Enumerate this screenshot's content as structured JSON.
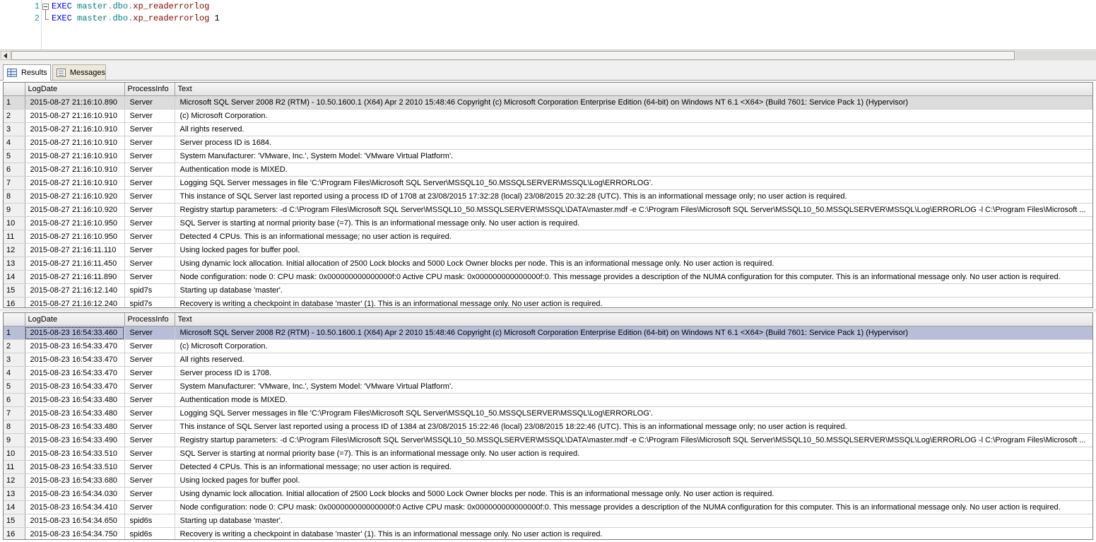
{
  "editor": {
    "lines": [
      {
        "num": "1",
        "exec": "EXEC",
        "db": "master",
        "dot1": ".",
        "schema": "dbo",
        "dot2": ".",
        "proc": "xp_readerrorlog",
        "arg": ""
      },
      {
        "num": "2",
        "exec": "EXEC",
        "db": "master",
        "dot1": ".",
        "schema": "dbo",
        "dot2": ".",
        "proc": "xp_readerrorlog",
        "arg": " 1"
      }
    ]
  },
  "tabs": {
    "results_label": "Results",
    "messages_label": "Messages",
    "results_icon": "grid-icon",
    "messages_icon": "messages-icon"
  },
  "columns": [
    "LogDate",
    "ProcessInfo",
    "Text"
  ],
  "grid1": {
    "rows": [
      {
        "n": "1",
        "date": "2015-08-27 21:16:10.890",
        "proc": "Server",
        "text": "Microsoft SQL Server 2008 R2 (RTM) - 10.50.1600.1 (X64)    Apr  2 2010 15:48:46    Copyright (c) Microsoft Corporation    Enterprise Edition (64-bit) on Windows NT 6.1 <X64> (Build 7601: Service Pack 1) (Hypervisor)"
      },
      {
        "n": "2",
        "date": "2015-08-27 21:16:10.910",
        "proc": "Server",
        "text": "(c) Microsoft Corporation."
      },
      {
        "n": "3",
        "date": "2015-08-27 21:16:10.910",
        "proc": "Server",
        "text": "All rights reserved."
      },
      {
        "n": "4",
        "date": "2015-08-27 21:16:10.910",
        "proc": "Server",
        "text": "Server process ID is 1684."
      },
      {
        "n": "5",
        "date": "2015-08-27 21:16:10.910",
        "proc": "Server",
        "text": "System Manufacturer: 'VMware, Inc.', System Model: 'VMware Virtual Platform'."
      },
      {
        "n": "6",
        "date": "2015-08-27 21:16:10.910",
        "proc": "Server",
        "text": "Authentication mode is MIXED."
      },
      {
        "n": "7",
        "date": "2015-08-27 21:16:10.910",
        "proc": "Server",
        "text": "Logging SQL Server messages in file 'C:\\Program Files\\Microsoft SQL Server\\MSSQL10_50.MSSQLSERVER\\MSSQL\\Log\\ERRORLOG'."
      },
      {
        "n": "8",
        "date": "2015-08-27 21:16:10.920",
        "proc": "Server",
        "text": "This instance of SQL Server last reported using a process ID of 1708 at 23/08/2015 17:32:28 (local) 23/08/2015 20:32:28 (UTC). This is an informational message only; no user action is required."
      },
      {
        "n": "9",
        "date": "2015-08-27 21:16:10.920",
        "proc": "Server",
        "text": "Registry startup parameters:      -d C:\\Program Files\\Microsoft SQL Server\\MSSQL10_50.MSSQLSERVER\\MSSQL\\DATA\\master.mdf      -e C:\\Program Files\\Microsoft SQL Server\\MSSQL10_50.MSSQLSERVER\\MSSQL\\Log\\ERRORLOG      -l C:\\Program Files\\Microsoft ..."
      },
      {
        "n": "10",
        "date": "2015-08-27 21:16:10.950",
        "proc": "Server",
        "text": "SQL Server is starting at normal priority base (=7). This is an informational message only. No user action is required."
      },
      {
        "n": "11",
        "date": "2015-08-27 21:16:10.950",
        "proc": "Server",
        "text": "Detected 4 CPUs. This is an informational message; no user action is required."
      },
      {
        "n": "12",
        "date": "2015-08-27 21:16:11.110",
        "proc": "Server",
        "text": "Using locked pages for buffer pool."
      },
      {
        "n": "13",
        "date": "2015-08-27 21:16:11.450",
        "proc": "Server",
        "text": "Using dynamic lock allocation.  Initial allocation of 2500 Lock blocks and 5000 Lock Owner blocks per node.  This is an informational message only.  No user action is required."
      },
      {
        "n": "14",
        "date": "2015-08-27 21:16:11.890",
        "proc": "Server",
        "text": "Node configuration: node 0: CPU mask: 0x000000000000000f:0 Active CPU mask: 0x000000000000000f:0. This message provides a description of the NUMA configuration for this computer. This is an informational message only. No user action is required."
      },
      {
        "n": "15",
        "date": "2015-08-27 21:16:12.140",
        "proc": "spid7s",
        "text": "Starting up database 'master'."
      },
      {
        "n": "16",
        "date": "2015-08-27 21:16:12.240",
        "proc": "spid7s",
        "text": "Recovery is writing a checkpoint in database 'master' (1). This is an informational message only. No user action is required."
      }
    ]
  },
  "grid2": {
    "rows": [
      {
        "n": "1",
        "date": "2015-08-23 16:54:33.460",
        "proc": "Server",
        "text": "Microsoft SQL Server 2008 R2 (RTM) - 10.50.1600.1 (X64)    Apr  2 2010 15:48:46    Copyright (c) Microsoft Corporation    Enterprise Edition (64-bit) on Windows NT 6.1 <X64> (Build 7601: Service Pack 1) (Hypervisor)"
      },
      {
        "n": "2",
        "date": "2015-08-23 16:54:33.470",
        "proc": "Server",
        "text": "(c) Microsoft Corporation."
      },
      {
        "n": "3",
        "date": "2015-08-23 16:54:33.470",
        "proc": "Server",
        "text": "All rights reserved."
      },
      {
        "n": "4",
        "date": "2015-08-23 16:54:33.470",
        "proc": "Server",
        "text": "Server process ID is 1708."
      },
      {
        "n": "5",
        "date": "2015-08-23 16:54:33.470",
        "proc": "Server",
        "text": "System Manufacturer: 'VMware, Inc.', System Model: 'VMware Virtual Platform'."
      },
      {
        "n": "6",
        "date": "2015-08-23 16:54:33.480",
        "proc": "Server",
        "text": "Authentication mode is MIXED."
      },
      {
        "n": "7",
        "date": "2015-08-23 16:54:33.480",
        "proc": "Server",
        "text": "Logging SQL Server messages in file 'C:\\Program Files\\Microsoft SQL Server\\MSSQL10_50.MSSQLSERVER\\MSSQL\\Log\\ERRORLOG'."
      },
      {
        "n": "8",
        "date": "2015-08-23 16:54:33.480",
        "proc": "Server",
        "text": "This instance of SQL Server last reported using a process ID of 1384 at 23/08/2015 15:22:46 (local) 23/08/2015 18:22:46 (UTC). This is an informational message only; no user action is required."
      },
      {
        "n": "9",
        "date": "2015-08-23 16:54:33.490",
        "proc": "Server",
        "text": "Registry startup parameters:      -d C:\\Program Files\\Microsoft SQL Server\\MSSQL10_50.MSSQLSERVER\\MSSQL\\DATA\\master.mdf      -e C:\\Program Files\\Microsoft SQL Server\\MSSQL10_50.MSSQLSERVER\\MSSQL\\Log\\ERRORLOG      -l C:\\Program Files\\Microsoft ..."
      },
      {
        "n": "10",
        "date": "2015-08-23 16:54:33.510",
        "proc": "Server",
        "text": "SQL Server is starting at normal priority base (=7). This is an informational message only. No user action is required."
      },
      {
        "n": "11",
        "date": "2015-08-23 16:54:33.510",
        "proc": "Server",
        "text": "Detected 4 CPUs. This is an informational message; no user action is required."
      },
      {
        "n": "12",
        "date": "2015-08-23 16:54:33.680",
        "proc": "Server",
        "text": "Using locked pages for buffer pool."
      },
      {
        "n": "13",
        "date": "2015-08-23 16:54:34.030",
        "proc": "Server",
        "text": "Using dynamic lock allocation.  Initial allocation of 2500 Lock blocks and 5000 Lock Owner blocks per node.  This is an informational message only.  No user action is required."
      },
      {
        "n": "14",
        "date": "2015-08-23 16:54:34.410",
        "proc": "Server",
        "text": "Node configuration: node 0: CPU mask: 0x000000000000000f:0 Active CPU mask: 0x000000000000000f:0. This message provides a description of the NUMA configuration for this computer. This is an informational message only. No user action is required."
      },
      {
        "n": "15",
        "date": "2015-08-23 16:54:34.650",
        "proc": "spid6s",
        "text": "Starting up database 'master'."
      },
      {
        "n": "16",
        "date": "2015-08-23 16:54:34.750",
        "proc": "spid6s",
        "text": "Recovery is writing a checkpoint in database 'master' (1). This is an informational message only. No user action is required."
      }
    ]
  },
  "colors": {
    "keyword": "#0000ff",
    "object": "#008080",
    "procedure": "#800000",
    "selected_row_grid1": "#dcdcdc",
    "selected_row_grid2": "#b8bed8"
  }
}
